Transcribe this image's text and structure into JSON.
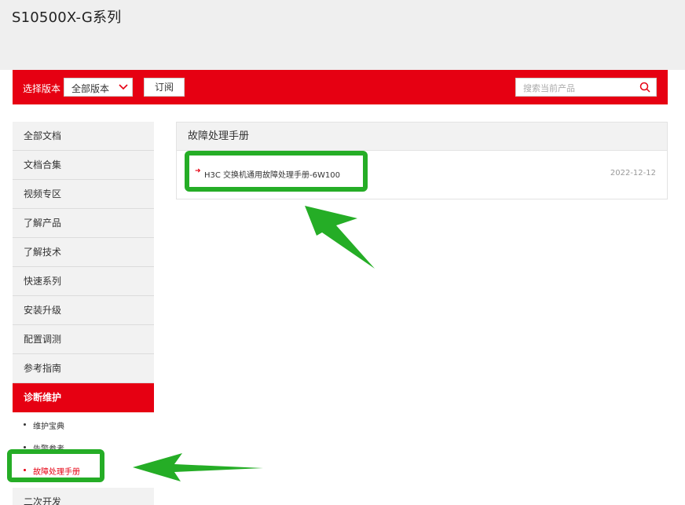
{
  "header": {
    "title": "S10500X-G系列"
  },
  "toolbar": {
    "version_label": "选择版本",
    "version_value": "全部版本",
    "subscribe_label": "订阅",
    "search_placeholder": "搜索当前产品"
  },
  "sidebar": {
    "items": [
      {
        "label": "全部文档"
      },
      {
        "label": "文档合集"
      },
      {
        "label": "视频专区"
      },
      {
        "label": "了解产品"
      },
      {
        "label": "了解技术"
      },
      {
        "label": "快速系列"
      },
      {
        "label": "安装升级"
      },
      {
        "label": "配置调测"
      },
      {
        "label": "参考指南"
      },
      {
        "label": "诊断维护"
      },
      {
        "label": "二次开发"
      }
    ],
    "sub_items": [
      {
        "label": "维护宝典"
      },
      {
        "label": "告警参考"
      },
      {
        "label": "故障处理手册"
      }
    ]
  },
  "main": {
    "section_title": "故障处理手册",
    "documents": [
      {
        "title": "H3C 交换机通用故障处理手册-6W100",
        "date": "2022-12-12"
      }
    ]
  },
  "colors": {
    "brand_red": "#e60012",
    "highlight_green": "#25ad26"
  }
}
